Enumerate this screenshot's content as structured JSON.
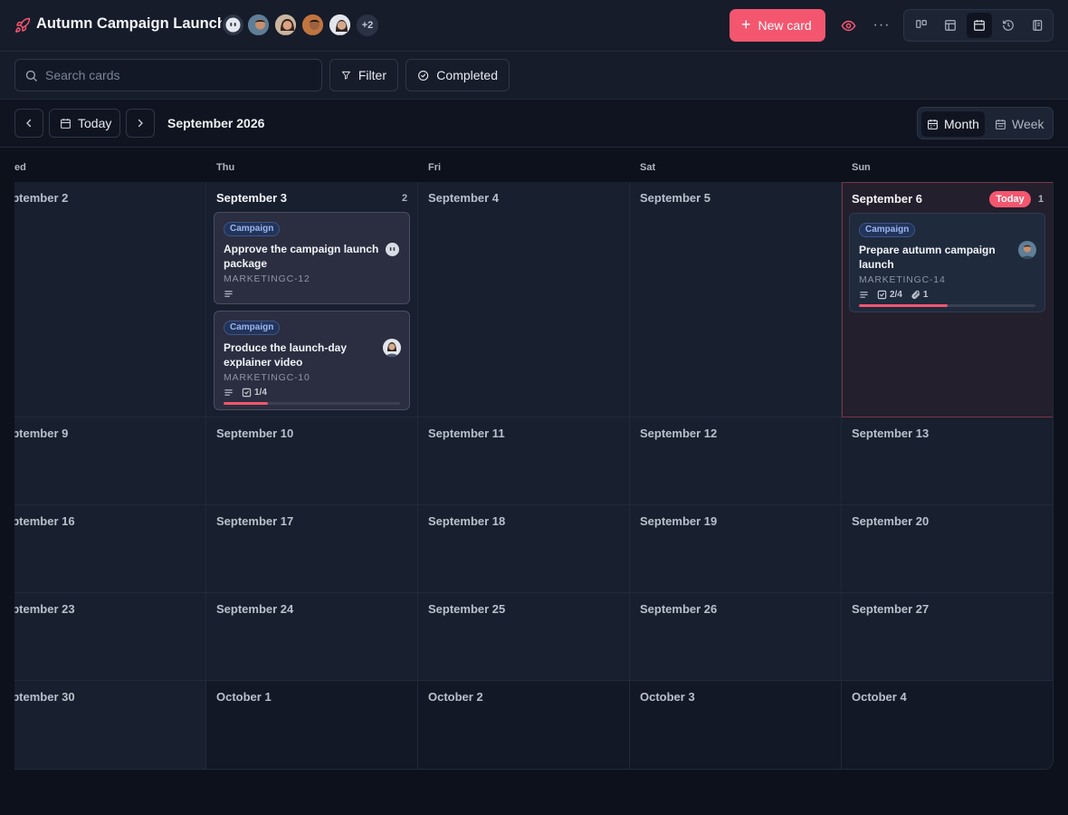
{
  "header": {
    "title": "Autumn Campaign Launch",
    "brand_icon": "rocket-icon",
    "members_more": "+2",
    "new_card_label": "New card",
    "accent": "#f4566f"
  },
  "toolbar": {
    "search_placeholder": "Search cards",
    "filter_label": "Filter",
    "completed_label": "Completed"
  },
  "calendar": {
    "today_label": "Today",
    "month_label": "September 2026",
    "view_month": "Month",
    "view_week": "Week",
    "day_headers": [
      "ed",
      "Thu",
      "Fri",
      "Sat",
      "Sun"
    ],
    "today_badge": "Today",
    "rows": [
      [
        "eptember 2",
        "September 3",
        "September 4",
        "September 5",
        "September 6"
      ],
      [
        "eptember 9",
        "September 10",
        "September 11",
        "September 12",
        "September 13"
      ],
      [
        "eptember 16",
        "September 17",
        "September 18",
        "September 19",
        "September 20"
      ],
      [
        "eptember 23",
        "September 24",
        "September 25",
        "September 26",
        "September 27"
      ],
      [
        "eptember 30",
        "October 1",
        "October 2",
        "October 3",
        "October 4"
      ]
    ],
    "counts": {
      "sep3": "2",
      "sep6": "1"
    }
  },
  "cards": [
    {
      "tag": "Campaign",
      "title": "Approve the campaign launch package",
      "id": "MARKETINGC-12",
      "checklist": "",
      "attachments": ""
    },
    {
      "tag": "Campaign",
      "title": "Produce the launch-day explainer video",
      "id": "MARKETINGC-10",
      "checklist": "1/4",
      "progress": 0.25
    },
    {
      "tag": "Campaign",
      "title": "Prepare autumn campaign launch",
      "id": "MARKETINGC-14",
      "checklist": "2/4",
      "attachments": "1",
      "progress": 0.5
    }
  ]
}
